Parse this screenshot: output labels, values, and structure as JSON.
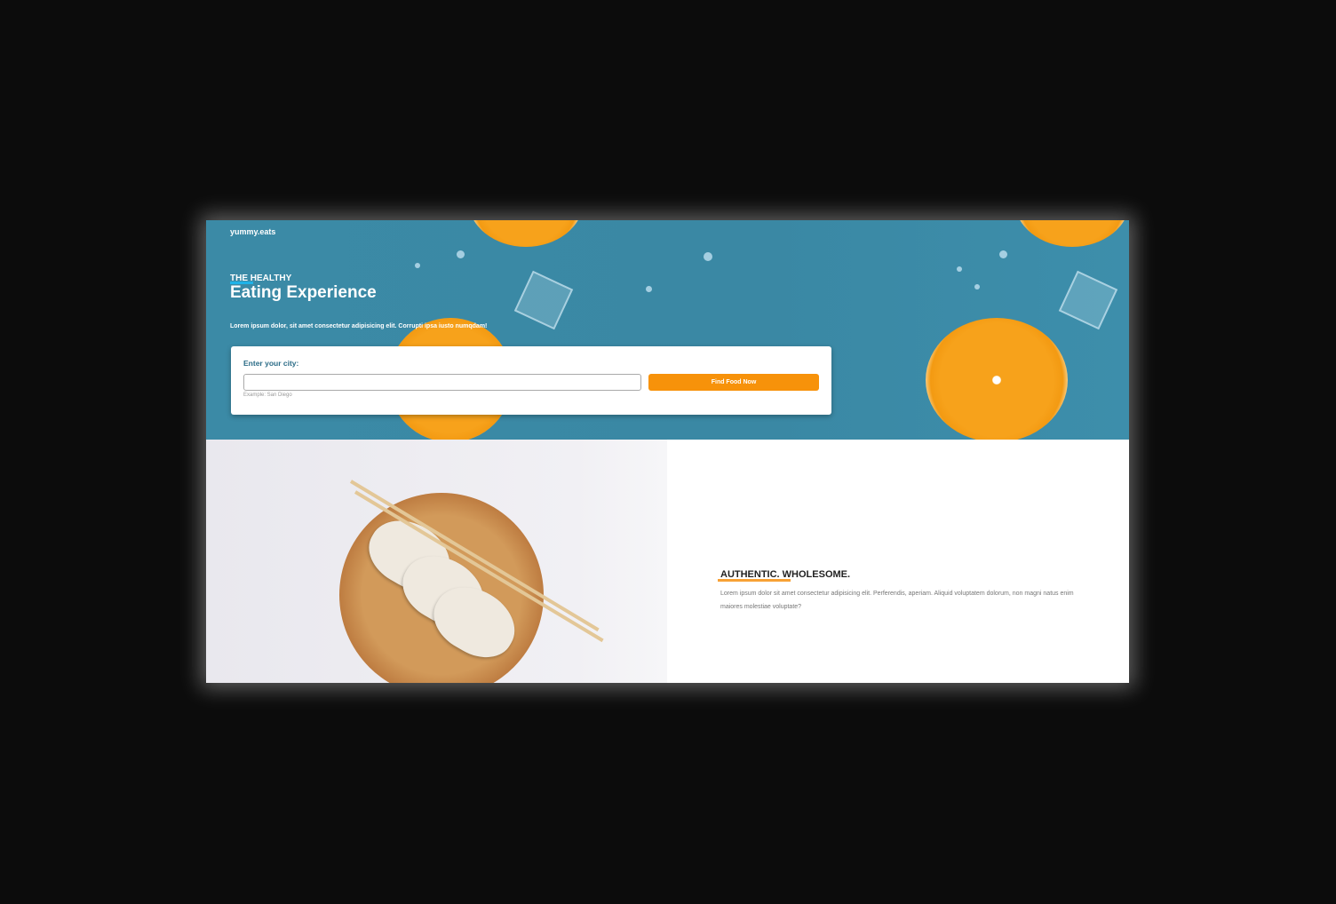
{
  "brand": {
    "logo": "yummy.eats"
  },
  "hero": {
    "kicker": "THE HEALTHY",
    "title": "Eating Experience",
    "subtitle": "Lorem ipsum dolor, sit amet consectetur adipisicing elit. Corrupti ipsa iusto numqdam!"
  },
  "search": {
    "label": "Enter your city:",
    "value": "",
    "hint": "Example: San Diego",
    "button": "Find Food Now"
  },
  "about": {
    "heading": "AUTHENTIC. WHOLESOME.",
    "text": "Lorem ipsum dolor sit amet consectetur adipisicing elit. Perferendis, aperiam. Aliquid voluptatem dolorum, non magni natus enim maiores molestiae voluptate?"
  },
  "colors": {
    "accent": "#f7920a",
    "hero_bg": "#3b8aa6",
    "kicker_underline": "#1fb3e8"
  }
}
